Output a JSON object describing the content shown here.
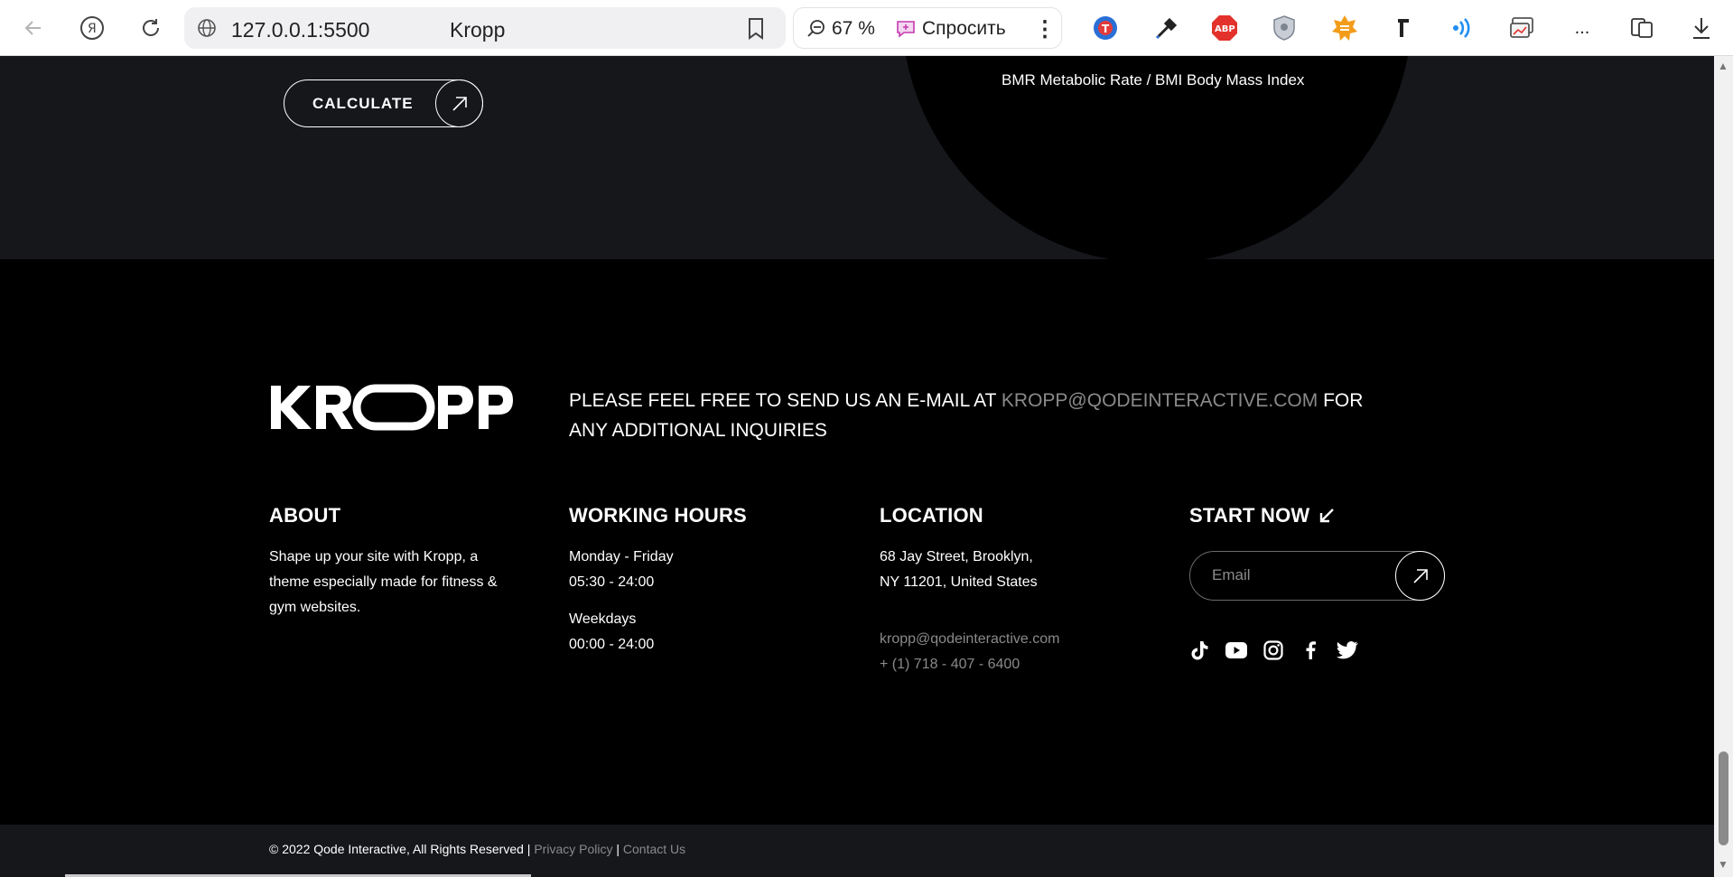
{
  "browser": {
    "url": "127.0.0.1:5500",
    "tab_title": "Kropp",
    "zoom": "67 %",
    "ask_label": "Спросить",
    "more_label": "..."
  },
  "hero": {
    "calculate_label": "CALCULATE",
    "bmr_caption": "BMR Metabolic Rate / BMI Body Mass Index"
  },
  "footer": {
    "logo_text": "KROPP",
    "contact_prefix": "PLEASE FEEL FREE TO SEND US AN E-MAIL AT ",
    "contact_email": "KROPP@QODEINTERACTIVE.COM",
    "contact_suffix": " FOR ANY ADDITIONAL INQUIRIES",
    "about": {
      "title": "ABOUT",
      "text": "Shape up your site with Kropp, a theme especially made for fitness & gym websites."
    },
    "hours": {
      "title": "WORKING HOURS",
      "days1": "Monday - Friday",
      "time1": "05:30 - 24:00",
      "days2": "Weekdays",
      "time2": "00:00 - 24:00"
    },
    "location": {
      "title": "LOCATION",
      "address1": "68 Jay Street, Brooklyn,",
      "address2": "NY 11201, United States",
      "email": "kropp@qodeinteractive.com",
      "phone": "+ (1) 718 - 407 - 6400"
    },
    "start": {
      "title": "START NOW",
      "email_placeholder": "Email"
    },
    "socials": [
      "tiktok-icon",
      "youtube-icon",
      "instagram-icon",
      "facebook-icon",
      "twitter-icon"
    ],
    "copyright": "© 2022 Qode Interactive, All Rights Reserved | ",
    "privacy": "Privacy Policy",
    "separator": " | ",
    "contact_us": "Contact Us"
  },
  "colors": {
    "page_bg": "#000000",
    "section_bg": "#15171b",
    "muted_text": "#8a8a8a",
    "accent_white": "#ffffff"
  }
}
